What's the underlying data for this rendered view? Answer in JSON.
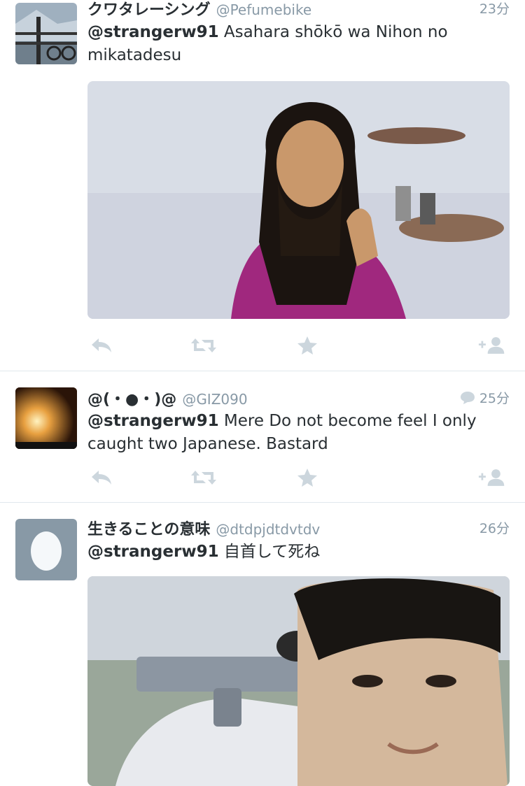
{
  "tweets": [
    {
      "name": "クワタレーシング",
      "handle": "@Pefumebike",
      "time": "23分",
      "mention": "@strangerw91",
      "text": "Asahara shōkō wa Nihon no mikatadesu"
    },
    {
      "name": "@(・●・)@",
      "handle": "@GIZ090",
      "time": "25分",
      "mention": "@strangerw91",
      "text": "Mere Do not become feel I only caught two Japanese. Bastard"
    },
    {
      "name": "生きることの意味",
      "handle": "@dtdpjdtdvtdv",
      "time": "26分",
      "mention": "@strangerw91",
      "text": "自首して死ね"
    }
  ],
  "icons": {
    "reply": "reply-icon",
    "retweet": "retweet-icon",
    "favorite": "star-icon",
    "follow": "follow-icon",
    "conversation": "speech-bubble-icon"
  },
  "colors": {
    "action_gray": "#ccd6dd",
    "meta_gray": "#8899a6",
    "text": "#292f33",
    "divider": "#e1e8ed"
  }
}
